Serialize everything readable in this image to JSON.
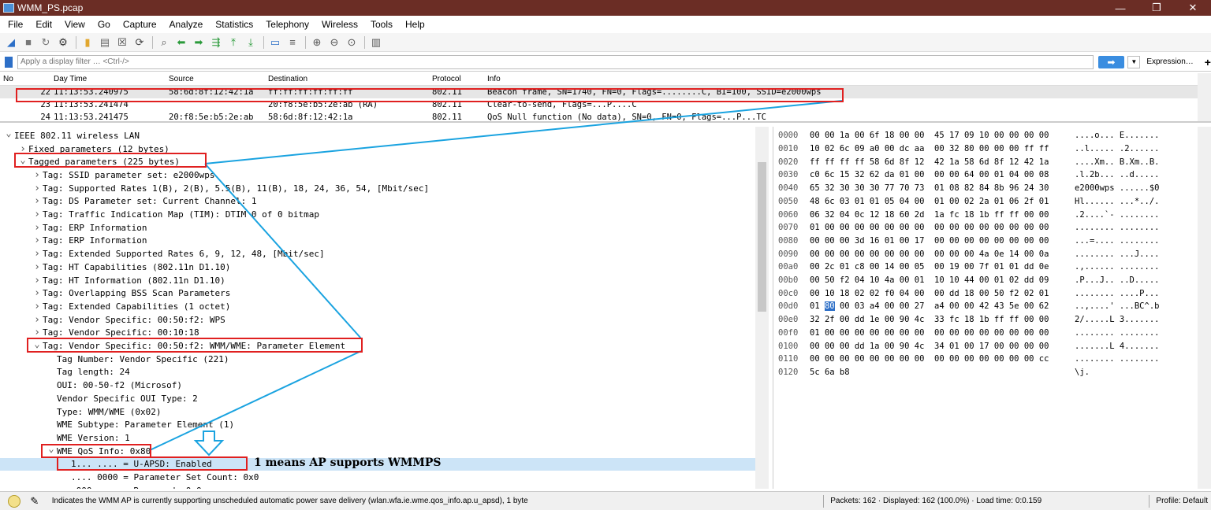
{
  "window": {
    "title": "WMM_PS.pcap",
    "minimize": "—",
    "maximize": "❐",
    "close": "✕"
  },
  "menu": [
    "File",
    "Edit",
    "View",
    "Go",
    "Capture",
    "Analyze",
    "Statistics",
    "Telephony",
    "Wireless",
    "Tools",
    "Help"
  ],
  "toolbar": {
    "icons": [
      "shark-fin-start-icon",
      "stop-icon",
      "restart-icon",
      "options-gear-icon",
      "open-folder-icon",
      "save-file-icon",
      "close-file-icon",
      "reload-icon",
      "find-magnifier-icon",
      "go-back-icon",
      "go-forward-icon",
      "go-to-packet-icon",
      "first-packet-icon",
      "last-packet-icon",
      "autoscroll-icon",
      "colorize-icon",
      "zoom-in-icon",
      "zoom-out-icon",
      "zoom-normal-icon",
      "resize-columns-icon"
    ]
  },
  "filter": {
    "placeholder": "Apply a display filter … <Ctrl-/>",
    "expression_label": "Expression…",
    "add_label": "+"
  },
  "packet_list": {
    "columns": [
      "No",
      "Day Time",
      "Source",
      "Destination",
      "Protocol",
      "Info"
    ],
    "rows": [
      {
        "no": "22",
        "time": "11:13:53.240975",
        "src": "58:6d:8f:12:42:1a",
        "dst": "ff:ff:ff:ff:ff:ff",
        "proto": "802.11",
        "info": "Beacon frame, SN=1740, FN=0, Flags=........C, BI=100, SSID=e2000wps"
      },
      {
        "no": "23",
        "time": "11:13:53.241474",
        "src": "",
        "dst": "20:f8:5e:b5:2e:ab (RA)",
        "proto": "802.11",
        "info": "Clear-to-send, Flags=...P....C"
      },
      {
        "no": "24",
        "time": "11:13:53.241475",
        "src": "20:f8:5e:b5:2e:ab",
        "dst": "58:6d:8f:12:42:1a",
        "proto": "802.11",
        "info": "QoS Null function (No data), SN=0, FN=0, Flags=...P...TC"
      }
    ]
  },
  "detail": {
    "rows": [
      {
        "text": "IEEE 802.11 wireless LAN",
        "indent": 0,
        "arrow": "down"
      },
      {
        "text": "Fixed parameters (12 bytes)",
        "indent": 1,
        "arrow": "right"
      },
      {
        "text": "Tagged parameters (225 bytes)",
        "indent": 1,
        "arrow": "down"
      },
      {
        "text": "Tag: SSID parameter set: e2000wps",
        "indent": 2,
        "arrow": "right"
      },
      {
        "text": "Tag: Supported Rates 1(B), 2(B), 5.5(B), 11(B), 18, 24, 36, 54, [Mbit/sec]",
        "indent": 2,
        "arrow": "right"
      },
      {
        "text": "Tag: DS Parameter set: Current Channel: 1",
        "indent": 2,
        "arrow": "right"
      },
      {
        "text": "Tag: Traffic Indication Map (TIM): DTIM 0 of 0 bitmap",
        "indent": 2,
        "arrow": "right"
      },
      {
        "text": "Tag: ERP Information",
        "indent": 2,
        "arrow": "right"
      },
      {
        "text": "Tag: ERP Information",
        "indent": 2,
        "arrow": "right"
      },
      {
        "text": "Tag: Extended Supported Rates 6, 9, 12, 48, [Mbit/sec]",
        "indent": 2,
        "arrow": "right"
      },
      {
        "text": "Tag: HT Capabilities (802.11n D1.10)",
        "indent": 2,
        "arrow": "right"
      },
      {
        "text": "Tag: HT Information (802.11n D1.10)",
        "indent": 2,
        "arrow": "right"
      },
      {
        "text": "Tag: Overlapping BSS Scan Parameters",
        "indent": 2,
        "arrow": "right"
      },
      {
        "text": "Tag: Extended Capabilities (1 octet)",
        "indent": 2,
        "arrow": "right"
      },
      {
        "text": "Tag: Vendor Specific: 00:50:f2: WPS",
        "indent": 2,
        "arrow": "right"
      },
      {
        "text": "Tag: Vendor Specific: 00:10:18",
        "indent": 2,
        "arrow": "right"
      },
      {
        "text": "Tag: Vendor Specific: 00:50:f2: WMM/WME: Parameter Element",
        "indent": 2,
        "arrow": "down"
      },
      {
        "text": "Tag Number: Vendor Specific (221)",
        "indent": 3,
        "arrow": ""
      },
      {
        "text": "Tag length: 24",
        "indent": 3,
        "arrow": ""
      },
      {
        "text": "OUI: 00-50-f2 (Microsof)",
        "indent": 3,
        "arrow": ""
      },
      {
        "text": "Vendor Specific OUI Type: 2",
        "indent": 3,
        "arrow": ""
      },
      {
        "text": "Type: WMM/WME (0x02)",
        "indent": 3,
        "arrow": ""
      },
      {
        "text": "WME Subtype: Parameter Element (1)",
        "indent": 3,
        "arrow": ""
      },
      {
        "text": "WME Version: 1",
        "indent": 3,
        "arrow": ""
      },
      {
        "text": "WME QoS Info: 0x80",
        "indent": 3,
        "arrow": "down"
      },
      {
        "text": "1... .... = U-APSD: Enabled",
        "indent": 4,
        "arrow": "",
        "highlight": true
      },
      {
        "text": ".... 0000 = Parameter Set Count: 0x0",
        "indent": 4,
        "arrow": ""
      },
      {
        "text": ".000 .... = Reserved: 0x0",
        "indent": 4,
        "arrow": ""
      }
    ]
  },
  "hex": {
    "rows": [
      {
        "off": "0000",
        "bytes": "00 00 1a 00 6f 18 00 00  45 17 09 10 00 00 00 00",
        "ascii": "....o... E......."
      },
      {
        "off": "0010",
        "bytes": "10 02 6c 09 a0 00 dc aa  00 32 80 00 00 00 ff ff",
        "ascii": "..l..... .2......"
      },
      {
        "off": "0020",
        "bytes": "ff ff ff ff 58 6d 8f 12  42 1a 58 6d 8f 12 42 1a",
        "ascii": "....Xm.. B.Xm..B."
      },
      {
        "off": "0030",
        "bytes": "c0 6c 15 32 62 da 01 00  00 00 64 00 01 04 00 08",
        "ascii": ".l.2b... ..d....."
      },
      {
        "off": "0040",
        "bytes": "65 32 30 30 30 77 70 73  01 08 82 84 8b 96 24 30",
        "ascii": "e2000wps ......$0"
      },
      {
        "off": "0050",
        "bytes": "48 6c 03 01 01 05 04 00  01 00 02 2a 01 06 2f 01",
        "ascii": "Hl...... ...*../."
      },
      {
        "off": "0060",
        "bytes": "06 32 04 0c 12 18 60 2d  1a fc 18 1b ff ff 00 00",
        "ascii": ".2....`- ........"
      },
      {
        "off": "0070",
        "bytes": "01 00 00 00 00 00 00 00  00 00 00 00 00 00 00 00",
        "ascii": "........ ........"
      },
      {
        "off": "0080",
        "bytes": "00 00 00 3d 16 01 00 17  00 00 00 00 00 00 00 00",
        "ascii": "...=.... ........"
      },
      {
        "off": "0090",
        "bytes": "00 00 00 00 00 00 00 00  00 00 00 4a 0e 14 00 0a",
        "ascii": "........ ...J...."
      },
      {
        "off": "00a0",
        "bytes": "00 2c 01 c8 00 14 00 05  00 19 00 7f 01 01 dd 0e",
        "ascii": ".,...... ........"
      },
      {
        "off": "00b0",
        "bytes": "00 50 f2 04 10 4a 00 01  10 10 44 00 01 02 dd 09",
        "ascii": ".P...J.. ..D....."
      },
      {
        "off": "00c0",
        "bytes": "00 10 18 02 02 f0 04 00  00 dd 18 00 50 f2 02 01",
        "ascii": "........ ....P..."
      },
      {
        "off": "00d0",
        "bytes": "01 80 00 03 a4 00 00 27  a4 00 00 42 43 5e 00 62",
        "ascii": "..,....' ...BC^.b",
        "sel_byte": "80"
      },
      {
        "off": "00e0",
        "bytes": "32 2f 00 dd 1e 00 90 4c  33 fc 18 1b ff ff 00 00",
        "ascii": "2/.....L 3......."
      },
      {
        "off": "00f0",
        "bytes": "01 00 00 00 00 00 00 00  00 00 00 00 00 00 00 00",
        "ascii": "........ ........"
      },
      {
        "off": "0100",
        "bytes": "00 00 00 dd 1a 00 90 4c  34 01 00 17 00 00 00 00",
        "ascii": ".......L 4......."
      },
      {
        "off": "0110",
        "bytes": "00 00 00 00 00 00 00 00  00 00 00 00 00 00 00 cc",
        "ascii": "........ ........"
      },
      {
        "off": "0120",
        "bytes": "5c 6a b8",
        "ascii": "\\j."
      }
    ]
  },
  "status": {
    "message": "Indicates the WMM AP is currently supporting unscheduled automatic power save delivery (wlan.wfa.ie.wme.qos_info.ap.u_apsd), 1 byte",
    "packets": "Packets: 162 · Displayed: 162 (100.0%) · Load time: 0:0.159",
    "profile": "Profile: Default"
  },
  "annotation": {
    "text": "1 means AP supports WMMPS",
    "box_color": "#e02020",
    "line_color": "#1aa3e0"
  }
}
